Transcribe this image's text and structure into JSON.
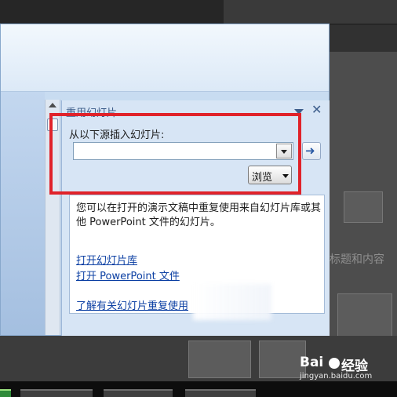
{
  "background": {
    "text_fragment_1": "标题和内容"
  },
  "task_pane": {
    "title": "重用幻灯片",
    "source_label": "从以下源插入幻灯片:",
    "source_value": "",
    "browse_label": "浏览",
    "info_text": "您可以在打开的演示文稿中重复使用来自幻灯片库或其他 PowerPoint 文件的幻灯片。",
    "link_open_library": "打开幻灯片库",
    "link_open_file": "打开 PowerPoint 文件",
    "link_learn_more": "了解有关幻灯片重复使用"
  },
  "watermark": {
    "brand_left": "Bai",
    "brand_right": "经验",
    "url": "jingyan.baidu.com"
  },
  "colors": {
    "highlight": "#e0222a",
    "link": "#0b3fa3",
    "pane_background": "#d7e5f5"
  }
}
